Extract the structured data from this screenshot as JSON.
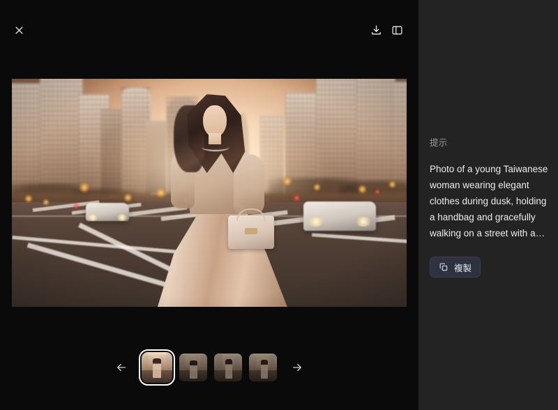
{
  "window": {
    "background_color": "#0a0a0a",
    "panel_color": "#232323"
  },
  "toolbar": {
    "close_label": "close-icon",
    "download_label": "download-icon",
    "panel_toggle_label": "side-panel-icon"
  },
  "main_image": {
    "alt": "Photo of a young Taiwanese woman in elegant clothes walking on a city street at dusk holding a handbag"
  },
  "gallery": {
    "prev_label": "previous-arrow",
    "next_label": "next-arrow",
    "selected_index": 0,
    "thumbnails": [
      {
        "alt": "woman walking on street at dusk, variant 1",
        "selected": true
      },
      {
        "alt": "woman walking on street at dusk, variant 2",
        "selected": false
      },
      {
        "alt": "woman walking on street at dusk, variant 3",
        "selected": false
      },
      {
        "alt": "woman walking on street at dusk, variant 4",
        "selected": false
      }
    ]
  },
  "side_panel": {
    "prompt_label": "提示",
    "prompt_text": "Photo of a young Taiwanese woman wearing elegant clothes during dusk, holding a handbag and gracefully walking on a street with a…",
    "copy_button_label": "複製"
  }
}
